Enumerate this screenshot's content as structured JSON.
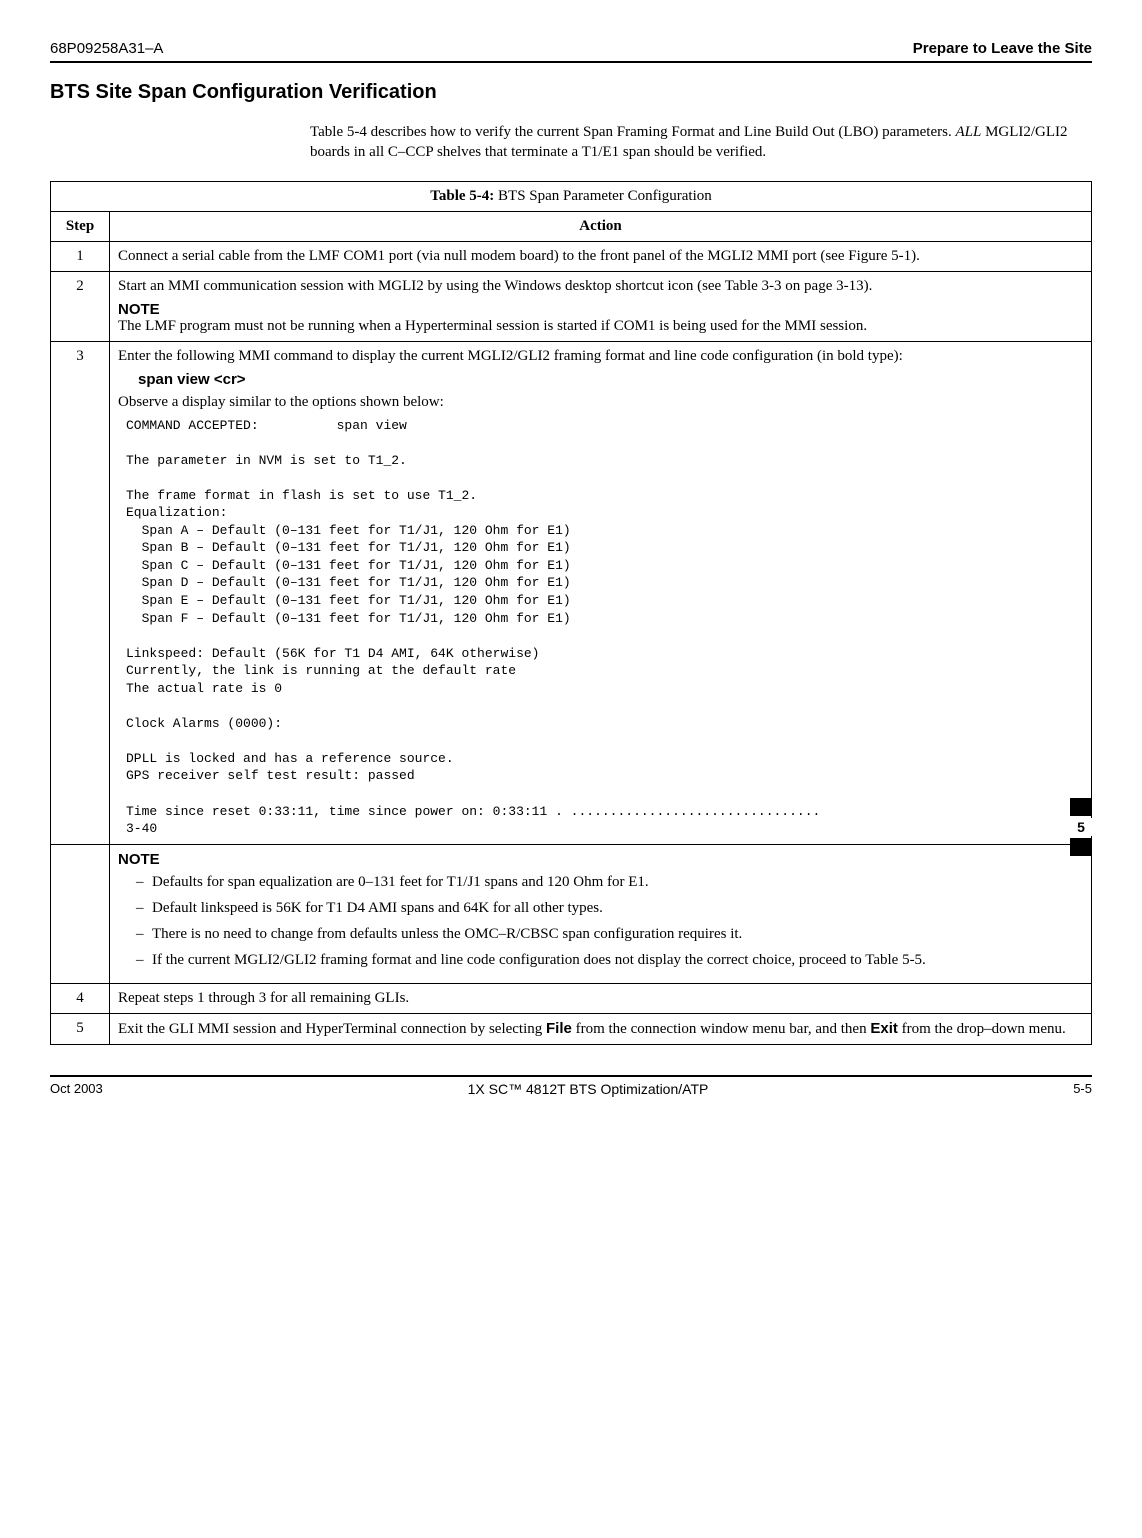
{
  "header": {
    "left": "68P09258A31–A",
    "right": "Prepare to Leave the Site"
  },
  "section_title": "BTS Site Span Configuration Verification",
  "intro": {
    "line1a": "Table 5-4 describes how to verify the current Span Framing Format and Line Build Out (LBO) parameters. ",
    "all": "ALL",
    "line1b": " MGLI2/GLI2 boards in all C–CCP shelves that terminate a T1/E1 span should be verified."
  },
  "table": {
    "caption_strong": "Table 5-4:",
    "caption_rest": " BTS Span Parameter Configuration",
    "col_step": "Step",
    "col_action": "Action",
    "rows": {
      "r1": {
        "num": "1",
        "text": "Connect a serial cable from the LMF COM1 port (via null modem board) to the front panel of the MGLI2 MMI port (see Figure 5-1)."
      },
      "r2": {
        "num": "2",
        "text1": "Start an MMI communication session with MGLI2 by using the Windows desktop shortcut icon (see Table 3-3 on page 3-13).",
        "note_label": "NOTE",
        "note_text": "The LMF program must not be running when a Hyperterminal session is started if COM1 is being used for the MMI session."
      },
      "r3": {
        "num": "3",
        "text1": "Enter the following MMI command to display the current MGLI2/GLI2 framing format and line code configuration (in bold type):",
        "cmd": "span view <cr>",
        "text2": "Observe a display similar to the options shown below:",
        "terminal": "COMMAND ACCEPTED:          span view\n\nThe parameter in NVM is set to T1_2.\n\nThe frame format in flash is set to use T1_2.\nEqualization:\n  Span A – Default (0–131 feet for T1/J1, 120 Ohm for E1)\n  Span B – Default (0–131 feet for T1/J1, 120 Ohm for E1)\n  Span C – Default (0–131 feet for T1/J1, 120 Ohm for E1)\n  Span D – Default (0–131 feet for T1/J1, 120 Ohm for E1)\n  Span E – Default (0–131 feet for T1/J1, 120 Ohm for E1)\n  Span F – Default (0–131 feet for T1/J1, 120 Ohm for E1)\n\nLinkspeed: Default (56K for T1 D4 AMI, 64K otherwise)\nCurrently, the link is running at the default rate\nThe actual rate is 0\n\nClock Alarms (0000):\n\nDPLL is locked and has a reference source.\nGPS receiver self test result: passed\n\nTime since reset 0:33:11, time since power on: 0:33:11 . ................................\n3-40"
      },
      "rnote": {
        "note_label": "NOTE",
        "b1": "Defaults for span equalization are 0–131 feet for T1/J1 spans and 120 Ohm for E1.",
        "b2": "Default linkspeed is 56K for T1 D4 AMI spans and 64K for all other types.",
        "b3": "There is no need to change from defaults unless the OMC–R/CBSC span configuration requires it.",
        "b4": "If the current MGLI2/GLI2 framing format and line code configuration does not display the correct choice, proceed to Table 5-5."
      },
      "r4": {
        "num": "4",
        "text": "Repeat steps 1 through 3 for all remaining GLIs."
      },
      "r5": {
        "num": "5",
        "text1": "Exit the GLI MMI session and HyperTerminal connection by selecting ",
        "file": "File",
        "text2": " from the connection window menu bar, and then ",
        "exit": "Exit",
        "text3": " from the drop–down menu."
      }
    }
  },
  "side_tab": "5",
  "footer": {
    "left": "Oct 2003",
    "center": "1X SC™ 4812T BTS Optimization/ATP",
    "right": "5-5"
  }
}
